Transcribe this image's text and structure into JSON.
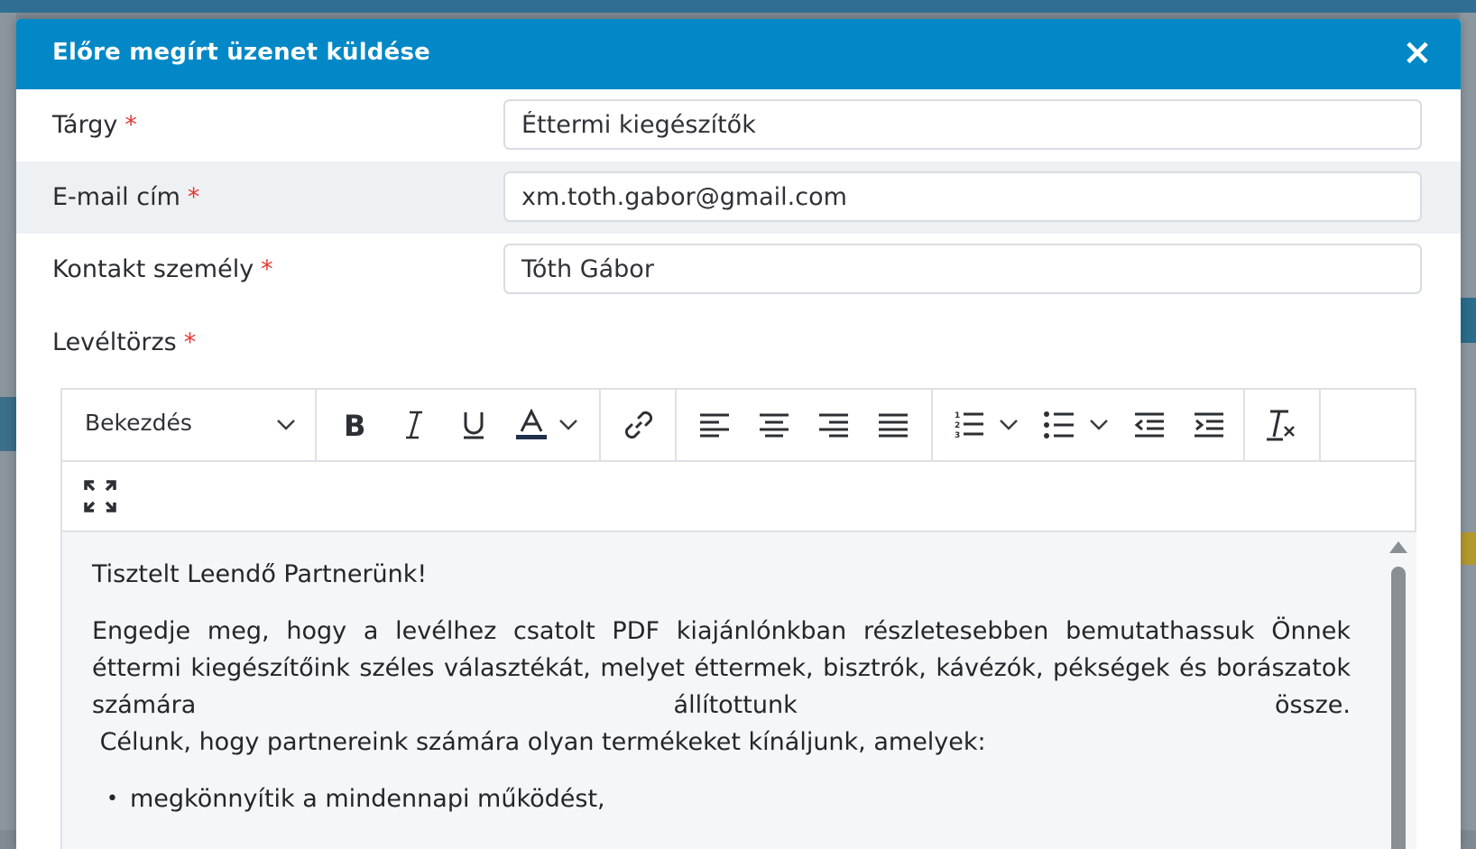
{
  "dialog": {
    "title": "Előre megírt üzenet küldése",
    "close_label": "×"
  },
  "form": {
    "subject": {
      "label": "Tárgy",
      "required_mark": "*",
      "value": "Éttermi kiegészítők"
    },
    "email": {
      "label": "E-mail cím",
      "required_mark": "*",
      "value": "xm.toth.gabor@gmail.com"
    },
    "contact": {
      "label": "Kontakt személy",
      "required_mark": "*",
      "value": "Tóth Gábor"
    },
    "body": {
      "label": "Levéltörzs",
      "required_mark": "*"
    }
  },
  "editor": {
    "format_select": "Bekezdés",
    "toolbar_icons": [
      "bold-icon",
      "italic-icon",
      "underline-icon",
      "text-color-icon",
      "link-icon",
      "align-left-icon",
      "align-center-icon",
      "align-right-icon",
      "align-justify-icon",
      "numbered-list-icon",
      "bullet-list-icon",
      "outdent-icon",
      "indent-icon",
      "clear-formatting-icon",
      "fullscreen-icon"
    ],
    "content": {
      "greeting": "Tisztelt Leendő Partnerünk!",
      "para_justified": "Engedje meg, hogy a levélhez csatolt PDF kiajánlónkban részletesebben bemutathassuk Önnek éttermi kiegészítőink széles választékát, melyet éttermek, bisztrók, kávézók, pékségek és borászatok számára állítottunk össze.",
      "para_goal": " Célunk, hogy partnereink számára olyan termékeket kínáljunk, amelyek:",
      "bullets": [
        "megkönnyítik a mindennapi működést,"
      ]
    }
  },
  "colors": {
    "header": "#0288c7",
    "required": "#e53935",
    "alt_row": "#eef1f4",
    "editor_bg": "#f4f6f8"
  }
}
